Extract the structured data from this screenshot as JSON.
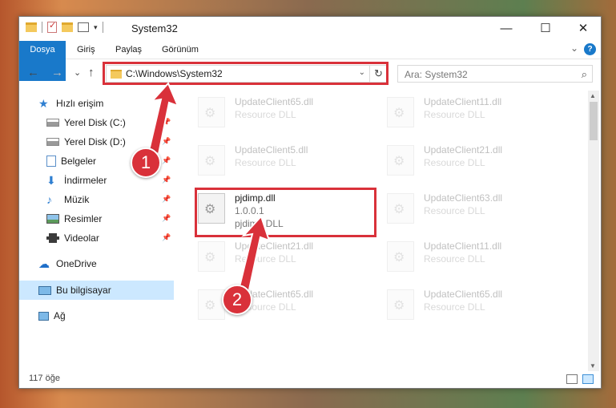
{
  "window": {
    "title": "System32",
    "minimize": "—",
    "maximize": "☐",
    "close": "✕"
  },
  "ribbon": {
    "tabs": [
      "Dosya",
      "Giriş",
      "Paylaş",
      "Görünüm"
    ],
    "help": "?"
  },
  "nav": {
    "back": "←",
    "forward": "→",
    "recent": "⌄",
    "up": "↑",
    "address": "C:\\Windows\\System32",
    "refresh": "↻",
    "search_placeholder": "Ara: System32"
  },
  "sidebar": {
    "items": [
      {
        "label": "Hızlı erişim",
        "icon": "star-icon"
      },
      {
        "label": "Yerel Disk (C:)",
        "icon": "drive-icon",
        "pinned": true
      },
      {
        "label": "Yerel Disk (D:)",
        "icon": "drive-icon",
        "pinned": true
      },
      {
        "label": "Belgeler",
        "icon": "documents-icon",
        "pinned": true
      },
      {
        "label": "İndirmeler",
        "icon": "download-icon",
        "pinned": true
      },
      {
        "label": "Müzik",
        "icon": "music-icon",
        "pinned": true
      },
      {
        "label": "Resimler",
        "icon": "pictures-icon",
        "pinned": true
      },
      {
        "label": "Videolar",
        "icon": "video-icon",
        "pinned": true
      },
      {
        "label": "OneDrive",
        "icon": "cloud-icon"
      },
      {
        "label": "Bu bilgisayar",
        "icon": "computer-icon",
        "selected": true
      },
      {
        "label": "Ağ",
        "icon": "network-icon"
      }
    ]
  },
  "files": {
    "left": [
      {
        "name": "UpdateClient65.dll",
        "desc": "Resource DLL"
      },
      {
        "name": "UpdateClient5.dll",
        "desc": "Resource DLL"
      },
      {
        "name": "pjdimp.dll",
        "version": "1.0.0.1",
        "desc": "pjdimp DLL"
      },
      {
        "name": "UpdateClient21.dll",
        "desc": "Resource DLL"
      },
      {
        "name": "UpdateClient65.dll",
        "desc": "Resource DLL"
      }
    ],
    "right": [
      {
        "name": "UpdateClient11.dll",
        "desc": "Resource DLL"
      },
      {
        "name": "UpdateClient21.dll",
        "desc": "Resource DLL"
      },
      {
        "name": "UpdateClient63.dll",
        "desc": "Resource DLL"
      },
      {
        "name": "UpdateClient11.dll",
        "desc": "Resource DLL"
      },
      {
        "name": "UpdateClient65.dll",
        "desc": "Resource DLL"
      }
    ]
  },
  "status": {
    "count": "117 öğe"
  },
  "annotations": {
    "step1": "1",
    "step2": "2",
    "color": "#d9313a"
  }
}
